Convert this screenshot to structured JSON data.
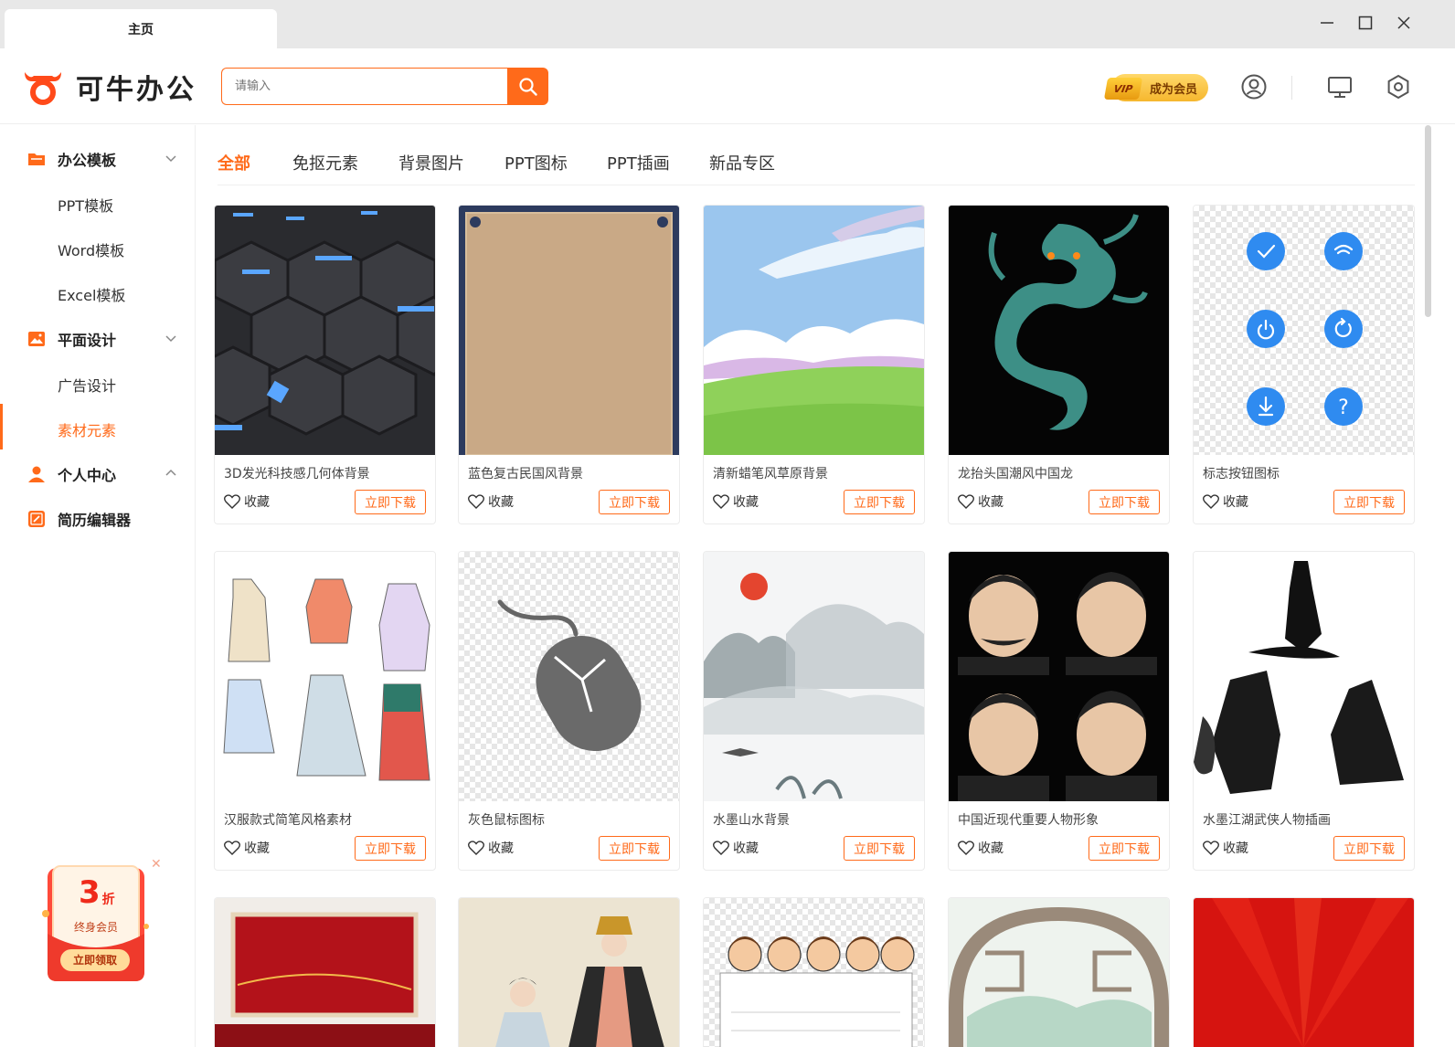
{
  "window": {
    "tab_title": "主页"
  },
  "header": {
    "logo_text": "可牛办公",
    "search_placeholder": "请输入",
    "vip_label": "成为会员",
    "vip_tag": "VIP"
  },
  "sidebar": {
    "groups": [
      {
        "label": "办公模板",
        "icon": "folder-icon",
        "expanded": true
      },
      {
        "label": "平面设计",
        "icon": "image-icon",
        "expanded": true
      },
      {
        "label": "个人中心",
        "icon": "user-icon",
        "expanded": true
      },
      {
        "label": "简历编辑器",
        "icon": "edit-icon"
      }
    ],
    "items": [
      {
        "label": "PPT模板"
      },
      {
        "label": "Word模板"
      },
      {
        "label": "Excel模板"
      },
      {
        "label": "广告设计"
      },
      {
        "label": "素材元素",
        "active": true
      }
    ],
    "promo": {
      "discount_number": "3",
      "discount_unit": "折",
      "subtitle": "终身会员",
      "button": "立即领取"
    }
  },
  "categories": {
    "tabs": [
      "全部",
      "免抠元素",
      "背景图片",
      "PPT图标",
      "PPT插画",
      "新品专区"
    ],
    "active_index": 0
  },
  "card_labels": {
    "favorite": "收藏",
    "download": "立即下载"
  },
  "cards": [
    {
      "title": "3D发光科技感几何体背景"
    },
    {
      "title": "蓝色复古民国风背景"
    },
    {
      "title": "清新蜡笔风草原背景"
    },
    {
      "title": "龙抬头国潮风中国龙"
    },
    {
      "title": "标志按钮图标"
    },
    {
      "title": "汉服款式简笔风格素材"
    },
    {
      "title": "灰色鼠标图标"
    },
    {
      "title": "水墨山水背景"
    },
    {
      "title": "中国近现代重要人物形象"
    },
    {
      "title": "水墨江湖武侠人物插画"
    }
  ],
  "colors": {
    "accent": "#ff6a1a",
    "vip_gold": "#f6b72e"
  }
}
